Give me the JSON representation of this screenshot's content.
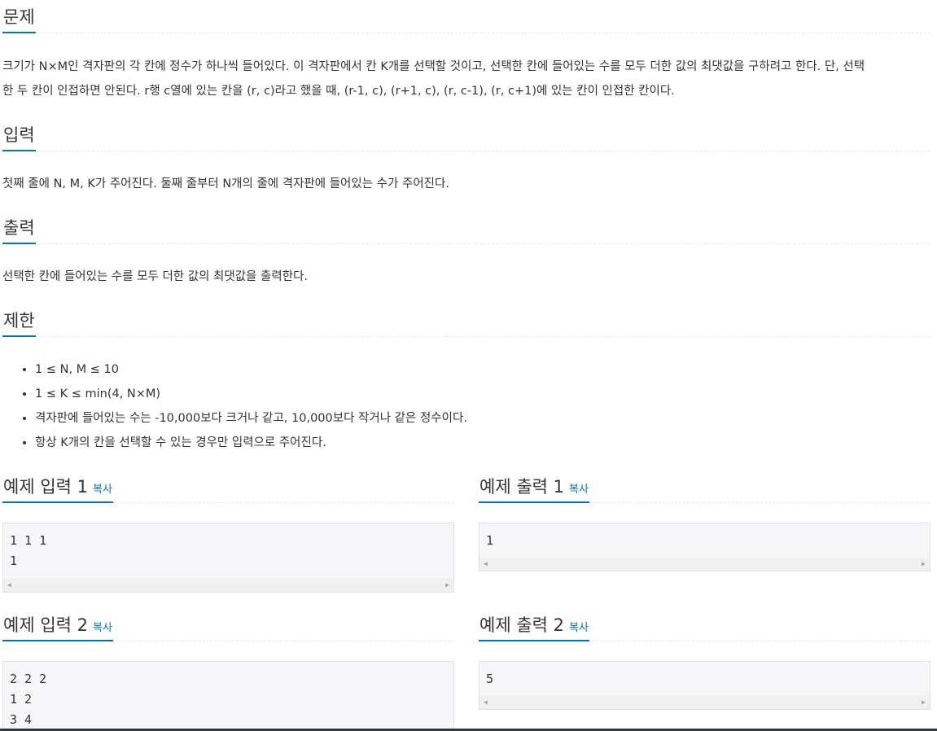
{
  "problem": {
    "title": "문제",
    "text_line1": "크기가 N×M인 격자판의 각 칸에 정수가 하나씩 들어있다. 이 격자판에서 칸 K개를 선택할 것이고, 선택한 칸에 들어있는 수를 모두 더한 값의 최댓값을 구하려고 한다. 단, 선택",
    "text_line2": "한 두 칸이 인접하면 안된다. r행 c열에 있는 칸을 (r, c)라고 했을 때, (r-1, c), (r+1, c), (r, c-1), (r, c+1)에 있는 칸이 인접한 칸이다."
  },
  "input": {
    "title": "입력",
    "text": "첫째 줄에 N, M, K가 주어진다. 둘째 줄부터 N개의 줄에 격자판에 들어있는 수가 주어진다."
  },
  "output": {
    "title": "출력",
    "text": "선택한 칸에 들어있는 수를 모두 더한 값의 최댓값을 출력한다."
  },
  "limits": {
    "title": "제한",
    "items": [
      "1 ≤ N, M ≤ 10",
      "1 ≤ K ≤ min(4, N×M)",
      "격자판에 들어있는 수는 -10,000보다 크거나 같고, 10,000보다 작거나 같은 정수이다.",
      "항상 K개의 칸을 선택할 수 있는 경우만 입력으로 주어진다."
    ]
  },
  "samples": {
    "copy_label": "복사",
    "input1": {
      "title": "예제 입력 1",
      "content": "1 1 1\n1"
    },
    "output1": {
      "title": "예제 출력 1",
      "content": "1"
    },
    "input2": {
      "title": "예제 입력 2",
      "content": "2 2 2\n1 2\n3 4"
    },
    "output2": {
      "title": "예제 출력 2",
      "content": "5"
    }
  },
  "icons": {
    "scroll_left": "scroll-left-arrow-icon",
    "scroll_right": "scroll-right-arrow-icon"
  },
  "colors": {
    "accent": "#0076c0",
    "sample_bg": "#f6f6f8"
  }
}
